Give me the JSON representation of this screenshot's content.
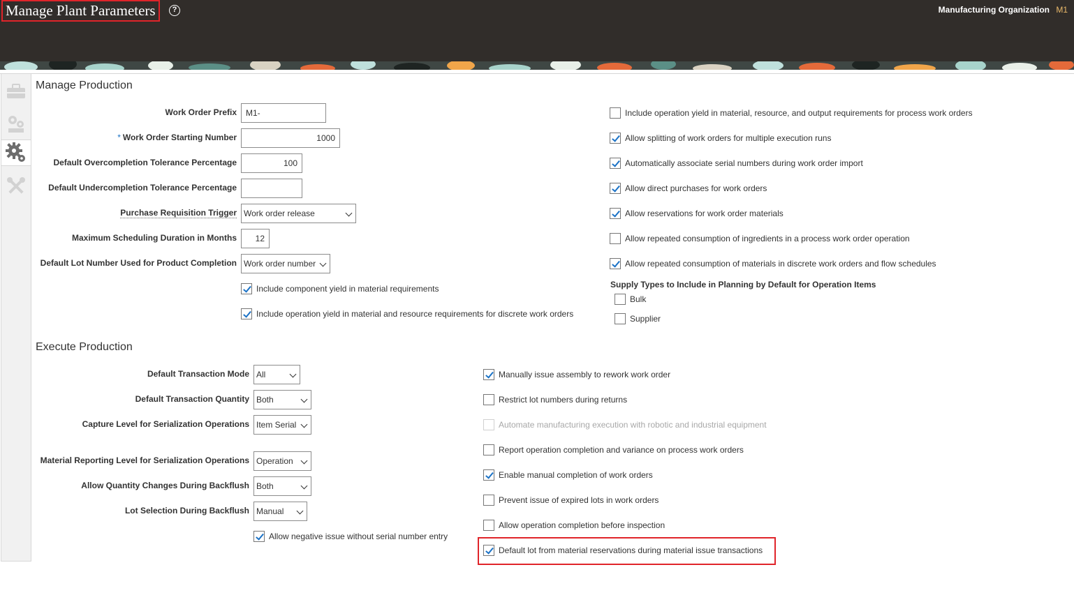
{
  "header": {
    "title": "Manage Plant Parameters",
    "help_icon": "question-circle-icon",
    "org_label": "Manufacturing Organization",
    "org_value": "M1"
  },
  "side_tabs": [
    {
      "icon": "toolbox-icon",
      "active": false
    },
    {
      "icon": "gears-icon",
      "active": false
    },
    {
      "icon": "gear-icon",
      "active": true
    },
    {
      "icon": "tools-icon",
      "active": false
    }
  ],
  "manage_production": {
    "title": "Manage Production",
    "work_order_prefix": {
      "label": "Work Order Prefix",
      "value": "M1-"
    },
    "work_order_starting_number": {
      "label": "Work Order Starting Number",
      "required": "*",
      "value": "1000"
    },
    "overcompletion": {
      "label": "Default Overcompletion Tolerance Percentage",
      "value": "100"
    },
    "undercompletion": {
      "label": "Default Undercompletion Tolerance Percentage",
      "value": ""
    },
    "purchase_requisition_trigger": {
      "label": "Purchase Requisition Trigger",
      "value": "Work order release"
    },
    "max_scheduling_duration": {
      "label": "Maximum Scheduling Duration in Months",
      "value": "12"
    },
    "default_lot_number": {
      "label": "Default Lot Number Used for Product Completion",
      "value": "Work order number"
    },
    "left_checkboxes": [
      {
        "label": "Include component yield in material requirements",
        "checked": true
      },
      {
        "label": "Include operation yield in material and resource requirements for discrete work orders",
        "checked": true
      }
    ],
    "right_checkboxes": [
      {
        "label": "Include operation yield in material, resource, and output requirements for process work orders",
        "checked": false
      },
      {
        "label": "Allow splitting of work orders for multiple execution runs",
        "checked": true
      },
      {
        "label": "Automatically associate serial numbers during work order import",
        "checked": true
      },
      {
        "label": "Allow direct purchases for work orders",
        "checked": true
      },
      {
        "label": "Allow reservations for work order materials",
        "checked": true
      },
      {
        "label": "Allow repeated consumption of ingredients in a process work order operation",
        "checked": false
      },
      {
        "label": "Allow repeated consumption of materials in discrete work orders and flow schedules",
        "checked": true
      }
    ],
    "supply_types": {
      "heading": "Supply Types to Include in Planning by Default for Operation Items",
      "items": [
        {
          "label": "Bulk",
          "checked": false
        },
        {
          "label": "Supplier",
          "checked": false
        }
      ]
    }
  },
  "execute_production": {
    "title": "Execute Production",
    "transaction_mode": {
      "label": "Default Transaction Mode",
      "value": "All"
    },
    "transaction_quantity": {
      "label": "Default Transaction Quantity",
      "value": "Both"
    },
    "capture_level": {
      "label": "Capture Level for Serialization Operations",
      "value": "Item Serial"
    },
    "material_reporting_level": {
      "label": "Material Reporting Level for Serialization Operations",
      "value": "Operation"
    },
    "quantity_changes_backflush": {
      "label": "Allow Quantity Changes During Backflush",
      "value": "Both"
    },
    "lot_selection_backflush": {
      "label": "Lot Selection During Backflush",
      "value": "Manual"
    },
    "left_checkboxes": [
      {
        "label": "Allow negative issue without serial number entry",
        "checked": true
      }
    ],
    "right_checkboxes": [
      {
        "label": "Manually issue assembly to rework work order",
        "checked": true,
        "disabled": false
      },
      {
        "label": "Restrict lot numbers during returns",
        "checked": false,
        "disabled": false
      },
      {
        "label": "Automate manufacturing execution with robotic and industrial equipment",
        "checked": false,
        "disabled": true
      },
      {
        "label": "Report operation completion and variance on process work orders",
        "checked": false,
        "disabled": false
      },
      {
        "label": "Enable manual completion of work orders",
        "checked": true,
        "disabled": false
      },
      {
        "label": "Prevent issue of expired lots in work orders",
        "checked": false,
        "disabled": false
      },
      {
        "label": "Allow operation completion before inspection",
        "checked": false,
        "disabled": false
      },
      {
        "label": "Default lot from material reservations during material issue transactions",
        "checked": true,
        "disabled": false
      }
    ]
  },
  "colors": {
    "header_bg": "#312d2a",
    "highlight": "#e0242a",
    "check": "#1b72c6",
    "org_value": "#e9b96a"
  }
}
